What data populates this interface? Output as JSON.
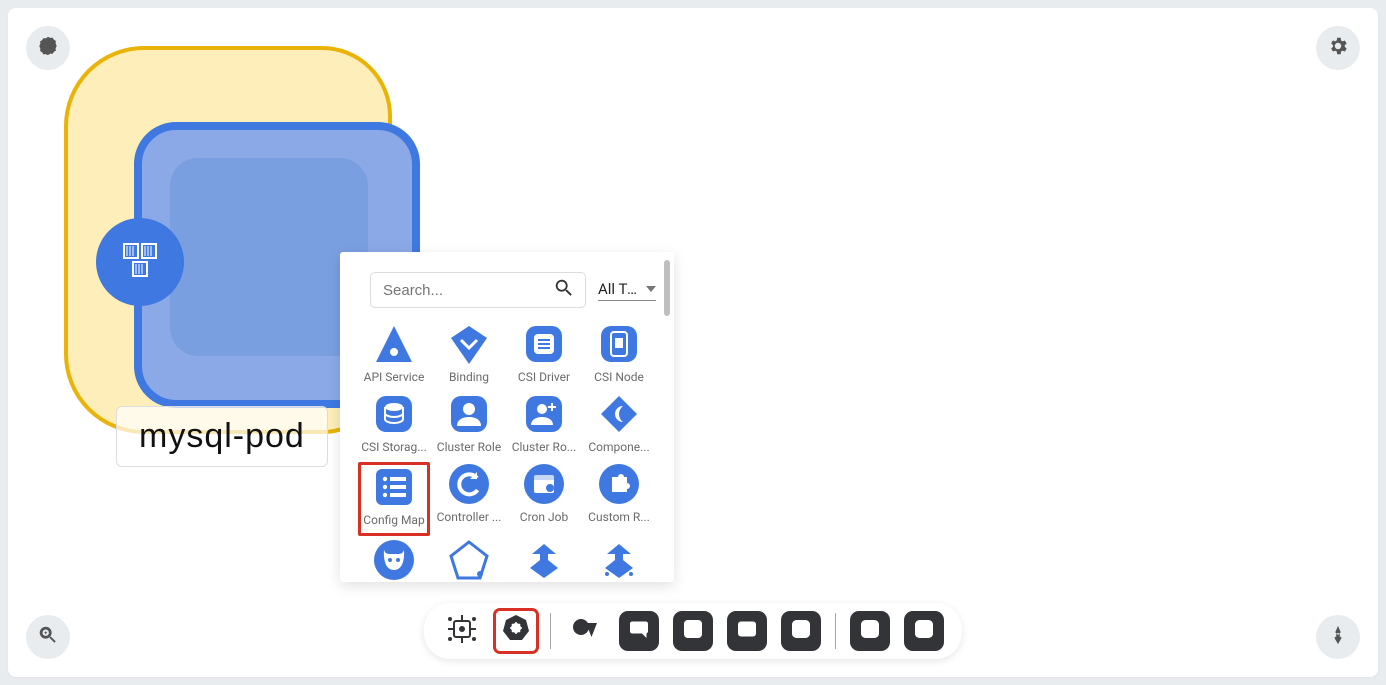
{
  "colors": {
    "primary": "#3f78e0",
    "accent": "#eab308",
    "highlight": "#d93025"
  },
  "corner_buttons": {
    "tl": "kubernetes-icon",
    "tr": "gear-icon",
    "bl": "zoom-in-icon",
    "br": "pen-nib-icon"
  },
  "node": {
    "label": "mysql-pod",
    "badge_icon": "containers-icon"
  },
  "picker": {
    "search_placeholder": "Search...",
    "filter_label": "All Types",
    "highlighted_item": "config-map",
    "items": [
      {
        "id": "api-service",
        "label": "API Service",
        "icon": "triangle"
      },
      {
        "id": "binding",
        "label": "Binding",
        "icon": "chevron-down-shield"
      },
      {
        "id": "csi-driver",
        "label": "CSI Driver",
        "icon": "drive-rounded"
      },
      {
        "id": "csi-node",
        "label": "CSI Node",
        "icon": "card-rounded"
      },
      {
        "id": "csi-storage",
        "label": "CSI Storag...",
        "icon": "db-rounded"
      },
      {
        "id": "cluster-role",
        "label": "Cluster Role",
        "icon": "user-rounded"
      },
      {
        "id": "cluster-role-binding",
        "label": "Cluster Ro...",
        "icon": "user-plus-rounded"
      },
      {
        "id": "component-status",
        "label": "Compone...",
        "icon": "diamond-moon"
      },
      {
        "id": "config-map",
        "label": "Config Map",
        "icon": "list-rounded"
      },
      {
        "id": "controller-revision",
        "label": "Controller ...",
        "icon": "refresh-circle"
      },
      {
        "id": "cron-job",
        "label": "Cron Job",
        "icon": "calendar-circle"
      },
      {
        "id": "custom-resource",
        "label": "Custom R...",
        "icon": "puzzle-circle"
      },
      {
        "id": "daemon-set",
        "label": "",
        "icon": "demon-circle"
      },
      {
        "id": "deployment",
        "label": "",
        "icon": "pentagon-outline"
      },
      {
        "id": "endpoint",
        "label": "",
        "icon": "down-split"
      },
      {
        "id": "endpoint-slice",
        "label": "",
        "icon": "down-split-dots"
      }
    ]
  },
  "toolbar": {
    "groups": [
      [
        "chip-icon",
        "kubernetes-wheel-icon"
      ],
      [
        "shapes-icon",
        "comment-icon",
        "text-icon",
        "panel-icon",
        "percent-icon"
      ],
      [
        "pen-draw-icon",
        "pencil-draw-icon"
      ]
    ],
    "highlighted": "kubernetes-wheel-icon"
  }
}
